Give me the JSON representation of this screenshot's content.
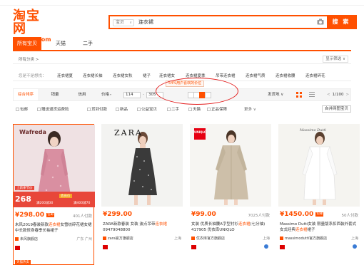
{
  "header": {
    "logo_cn": "淘宝网",
    "logo_en": "Taobao.com",
    "search_scope": "宝贝",
    "search_query": "连衣裙",
    "search_button": "搜 索"
  },
  "tabs": [
    "所有宝贝",
    "天猫",
    "二手"
  ],
  "category_row": {
    "label": "所有分类 >",
    "right": "显示筛选 ∨"
  },
  "keywords": {
    "label": "您是不是想找：",
    "items": [
      "连衣裙夏",
      "连衣裙长袖",
      "连衣裙女秋",
      "裙子",
      "连衣裙女",
      "连衣裙夏季",
      "吊带连衣裙",
      "连衣裙气质",
      "连衣裙收腰",
      "连衣裙碎花"
    ]
  },
  "sortbar": {
    "items": [
      "综合排序",
      "销量",
      "信用",
      "价格"
    ],
    "price_min": "114",
    "price_max": "305",
    "tooltip": "54%用户喜欢的价位",
    "ship_from": "发货地 ∨",
    "pager": "1/100",
    "prev": "<",
    "next": ">"
  },
  "filters": {
    "checkboxes": [
      "包邮",
      "赠送退货运费险",
      "货到付款",
      "新品",
      "公益宝贝",
      "二手",
      "天猫",
      "正品保障"
    ],
    "more": "更多 ∨",
    "national": "自并网图宝贝"
  },
  "products": [
    {
      "brand": "Wafreda",
      "price": "¥298.00",
      "tag": "包邮",
      "sold": "401人付款",
      "title_pre": "未风2019春装新款",
      "title_hot": "连衣裙",
      "title_post": "女雪纺碎花裙女裙中长款修身春季长袖裙子",
      "shop": "未风旗舰店",
      "location": "广东 广州",
      "banner_big": "268",
      "banner_s1": "上新季节价",
      "banner_s2": "满200减30",
      "banner_s3": "会员价",
      "banner_s4": "满400减70",
      "hot_badge": "天猫热卖"
    },
    {
      "brand": "ZARA",
      "price": "¥299.00",
      "tag": "",
      "sold": "",
      "title_pre": "ZARA新款春装 女装 波点吊带",
      "title_hot": "连衣裙",
      "title_post": " 09479048800",
      "shop": "zara官方旗舰店",
      "location": "上海"
    },
    {
      "brand": "UNIQLO",
      "price": "¥99.00",
      "tag": "",
      "sold": "7025人付款",
      "title_pre": "女装 优质长袖腰A字型衬衫",
      "title_hot": "连衣裙",
      "title_post": "(七分袖) 417905 优衣库UNIQLO",
      "shop": "优衣库官方旗舰店",
      "location": "上海"
    },
    {
      "brand": "Massimo Dutti",
      "price": "¥1450.00",
      "tag": "包邮",
      "sold": "50人付款",
      "title_pre": "Massimo Dutti女装 限量版系扣西装外套式女式经典",
      "title_hot": "连衣裙",
      "title_post": "裙子",
      "shop": "massimodutti官方旗舰店",
      "location": "上海"
    }
  ],
  "colors": {
    "accent": "#ff5000",
    "annotation": "#e31c1c"
  }
}
